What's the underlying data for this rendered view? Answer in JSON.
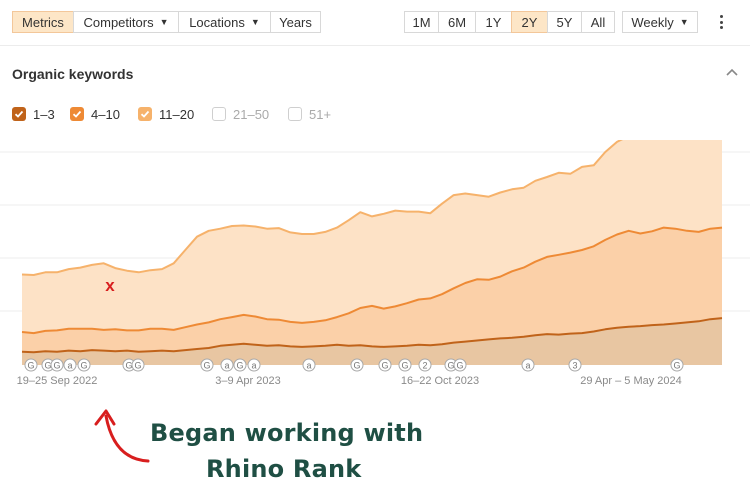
{
  "toolbar": {
    "tabs": [
      {
        "label": "Metrics",
        "active": true,
        "has_caret": false
      },
      {
        "label": "Competitors",
        "active": false,
        "has_caret": true
      },
      {
        "label": "Locations",
        "active": false,
        "has_caret": true
      },
      {
        "label": "Years",
        "active": false,
        "has_caret": false
      }
    ],
    "ranges": [
      {
        "label": "1M",
        "active": false
      },
      {
        "label": "6M",
        "active": false
      },
      {
        "label": "1Y",
        "active": false
      },
      {
        "label": "2Y",
        "active": true
      },
      {
        "label": "5Y",
        "active": false
      },
      {
        "label": "All",
        "active": false
      }
    ],
    "interval": {
      "label": "Weekly"
    }
  },
  "section": {
    "title": "Organic keywords"
  },
  "legend": [
    {
      "label": "1–3",
      "checked": true,
      "color": "#c0631a"
    },
    {
      "label": "4–10",
      "checked": true,
      "color": "#ee8a35"
    },
    {
      "label": "11–20",
      "checked": true,
      "color": "#f6b26b"
    },
    {
      "label": "21–50",
      "checked": false,
      "color": "#cfcfcf"
    },
    {
      "label": "51+",
      "checked": false,
      "color": "#cfcfcf"
    }
  ],
  "chart_data": {
    "type": "area",
    "stacked": true,
    "grid": true,
    "x_ticks": [
      "19–25 Sep 2022",
      "3–9 Apr 2023",
      "16–22 Oct 2023",
      "29 Apr – 5 May 2024"
    ],
    "markers": [
      "G",
      "G",
      "G",
      "a",
      "G",
      "G",
      "G",
      "G",
      "a",
      "G",
      "a",
      "a",
      "G",
      "G",
      "G",
      "2",
      "G",
      "G",
      "a",
      "3",
      "G"
    ],
    "annotation_mark": "x",
    "series": [
      {
        "name": "1–3",
        "color": "#c0631a",
        "values": [
          2.5,
          2.4,
          2.6,
          2.5,
          2.7,
          2.6,
          2.8,
          2.7,
          2.6,
          2.7,
          2.5,
          2.6,
          2.7,
          2.6,
          2.8,
          3.0,
          3.2,
          3.6,
          3.8,
          4.0,
          3.8,
          3.6,
          3.7,
          3.5,
          3.4,
          3.5,
          3.6,
          3.8,
          3.6,
          3.7,
          3.5,
          3.4,
          3.5,
          3.6,
          3.8,
          3.7,
          3.9,
          4.2,
          4.4,
          4.6,
          4.8,
          5.0,
          5.1,
          5.3,
          5.6,
          5.8,
          5.7,
          5.9,
          6.0,
          6.3,
          6.7,
          7.0,
          7.2,
          7.3,
          7.5,
          7.6,
          7.8,
          8.0,
          8.2,
          8.6,
          8.8
        ]
      },
      {
        "name": "4–10",
        "color": "#ee8a35",
        "values": [
          3.7,
          3.6,
          3.8,
          4.0,
          4.1,
          4.2,
          4.0,
          3.9,
          4.1,
          3.8,
          4.0,
          4.2,
          4.1,
          4.0,
          4.3,
          4.6,
          4.8,
          5.0,
          5.2,
          5.4,
          5.3,
          5.0,
          4.8,
          4.6,
          4.5,
          4.6,
          4.8,
          5.2,
          6.1,
          7.0,
          7.6,
          7.2,
          7.5,
          8.0,
          8.5,
          8.8,
          9.4,
          10.2,
          11.0,
          11.5,
          11.2,
          11.6,
          12.5,
          13.0,
          13.8,
          14.5,
          15.0,
          15.2,
          15.6,
          16.0,
          16.8,
          17.5,
          18.0,
          17.4,
          17.6,
          18.2,
          17.8,
          17.2,
          16.8,
          17.0,
          17.0
        ]
      },
      {
        "name": "11–20",
        "color": "#f6b26b",
        "values": [
          10.8,
          10.9,
          11.0,
          10.9,
          11.2,
          11.5,
          12.0,
          12.5,
          11.5,
          11.2,
          10.9,
          11.0,
          11.2,
          12.5,
          14.5,
          16.5,
          17.2,
          17.0,
          17.1,
          16.8,
          16.9,
          17.0,
          17.2,
          16.8,
          16.7,
          16.5,
          16.6,
          16.8,
          17.5,
          18.0,
          16.8,
          17.8,
          18.0,
          17.2,
          16.5,
          16.0,
          17.0,
          17.5,
          16.8,
          15.8,
          15.6,
          15.8,
          15.4,
          15.0,
          15.2,
          15.0,
          15.4,
          14.8,
          15.6,
          15.2,
          16.5,
          17.4,
          17.8,
          18.0,
          17.6,
          18.5,
          18.4,
          19.6,
          21.0,
          22.0,
          22.2
        ]
      }
    ]
  },
  "caption": {
    "line1": "Began working with",
    "line2": "Rhino Rank"
  }
}
